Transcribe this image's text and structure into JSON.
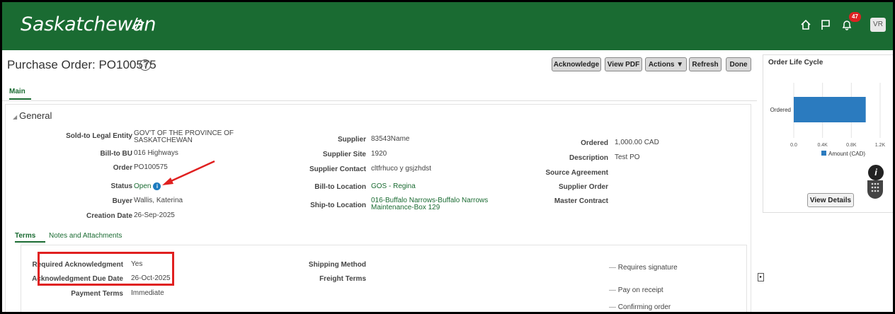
{
  "header": {
    "logo": "Saskatchewan",
    "notification_count": "47",
    "avatar": "VR",
    "brand_color": "#1a6b32"
  },
  "page": {
    "title": "Purchase Order: PO100575",
    "help": "?"
  },
  "toolbar": {
    "acknowledge": "Acknowledge",
    "view_pdf": "View PDF",
    "actions": "Actions ▼",
    "refresh": "Refresh",
    "done": "Done"
  },
  "tabs": {
    "main": "Main"
  },
  "general": {
    "heading": "General",
    "col1": [
      {
        "label": "Sold-to Legal Entity",
        "value": "GOV'T OF THE PROVINCE OF\nSASKATCHEWAN"
      },
      {
        "label": "Bill-to BU",
        "value": "016 Highways"
      },
      {
        "label": "Order",
        "value": "PO100575"
      },
      {
        "label": "Status",
        "value": "Open"
      },
      {
        "label": "Buyer",
        "value": "Wallis, Katerina"
      },
      {
        "label": "Creation Date",
        "value": "26-Sep-2025"
      }
    ],
    "col2": [
      {
        "label": "Supplier",
        "value": "83543Name"
      },
      {
        "label": "Supplier Site",
        "value": "1920"
      },
      {
        "label": "Supplier Contact",
        "value": "cltfrhuco y gsjzhdst"
      },
      {
        "label": "Bill-to Location",
        "value": "GOS - Regina"
      },
      {
        "label": "Ship-to Location",
        "value": "016-Buffalo Narrows-Buffalo Narrows\nMaintenance-Box 129"
      }
    ],
    "col3": [
      {
        "label": "Ordered",
        "value": "1,000.00 CAD"
      },
      {
        "label": "Description",
        "value": "Test PO"
      },
      {
        "label": "Source Agreement",
        "value": ""
      },
      {
        "label": "Supplier Order",
        "value": ""
      },
      {
        "label": "Master Contract",
        "value": ""
      }
    ]
  },
  "subtabs": {
    "terms": "Terms",
    "notes": "Notes and Attachments"
  },
  "terms": {
    "col1": [
      {
        "label": "Required Acknowledgment",
        "value": "Yes"
      },
      {
        "label": "Acknowledgment Due Date",
        "value": "26-Oct-2025"
      },
      {
        "label": "Payment Terms",
        "value": "Immediate"
      }
    ],
    "col2": [
      {
        "label": "Shipping Method",
        "value": ""
      },
      {
        "label": "Freight Terms",
        "value": ""
      }
    ],
    "col3": [
      "Requires signature",
      "Pay on receipt",
      "Confirming order"
    ]
  },
  "order_life_cycle": {
    "title": "Order Life Cycle",
    "view_details": "View Details"
  },
  "chart_data": {
    "type": "bar",
    "orientation": "horizontal",
    "categories": [
      "Ordered"
    ],
    "series": [
      {
        "name": "Amount (CAD)",
        "values": [
          1000
        ],
        "color": "#2b7bbf"
      }
    ],
    "xticks": [
      "0.0",
      "0.4K",
      "0.8K",
      "1.2K"
    ],
    "xlim": [
      0,
      1200
    ]
  }
}
